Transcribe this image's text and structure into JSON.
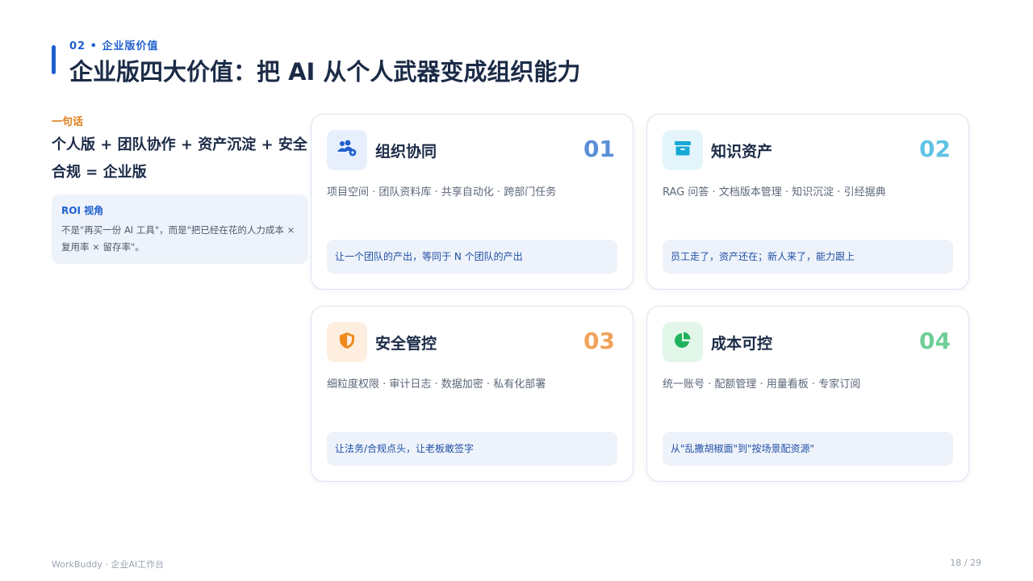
{
  "header": {
    "section_tag": "02 • 企业版价值",
    "title": "企业版四大价值：把 AI 从个人武器变成组织能力"
  },
  "summary": {
    "label": "一句话",
    "text": "个人版 + 团队协作 + 资产沉淀 + 安全合规 = 企业版",
    "roi": {
      "title": "ROI 视角",
      "body": "不是\"再买一份 AI 工具\"，而是\"把已经在花的人力成本 × 复用率 × 留存率\"。"
    }
  },
  "cards": [
    {
      "title": "组织协同",
      "number": "01",
      "icon": "team-gear-icon",
      "accent": "#5b8fd6",
      "icon_bg": "#e6effb",
      "description": "项目空间 · 团队资料库 · 共享自动化 · 跨部门任务",
      "slogan": "让一个团队的产出，等同于 N 个团队的产出"
    },
    {
      "title": "知识资产",
      "number": "02",
      "icon": "archive-box-icon",
      "accent": "#5fc3e6",
      "icon_bg": "#e3f5fb",
      "description": "RAG 问答 · 文档版本管理 · 知识沉淀 · 引经据典",
      "slogan": "员工走了，资产还在；新人来了，能力跟上"
    },
    {
      "title": "安全管控",
      "number": "03",
      "icon": "shield-icon",
      "accent": "#f0a35a",
      "icon_bg": "#fdeee0",
      "description": "细粒度权限 · 审计日志 · 数据加密 · 私有化部署",
      "slogan": "让法务/合规点头，让老板敢签字"
    },
    {
      "title": "成本可控",
      "number": "04",
      "icon": "pie-chart-icon",
      "accent": "#6fcf97",
      "icon_bg": "#e3f6ea",
      "description": "统一账号 · 配额管理 · 用量看板 · 专家订阅",
      "slogan": "从\"乱撒胡椒面\"到\"按场景配资源\""
    }
  ],
  "footer": {
    "left": "WorkBuddy · 企业AI工作台",
    "page": "18 / 29"
  }
}
